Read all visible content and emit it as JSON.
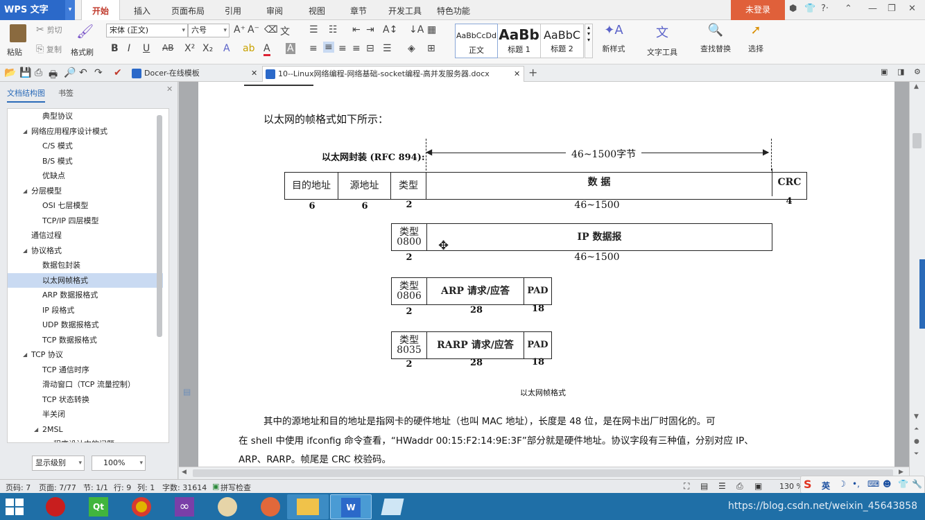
{
  "app": {
    "logo": "WPS 文字"
  },
  "menu_tabs": [
    "开始",
    "插入",
    "页面布局",
    "引用",
    "审阅",
    "视图",
    "章节",
    "开发工具",
    "特色功能"
  ],
  "login_label": "未登录",
  "ribbon": {
    "paste": "粘贴",
    "cut": "剪切",
    "copy": "复制",
    "format_painter": "格式刷",
    "font_name": "宋体 (正文)",
    "font_size": "六号",
    "styles": [
      {
        "preview": "AaBbCcDd",
        "name": "正文"
      },
      {
        "preview": "AaBb",
        "name": "标题 1"
      },
      {
        "preview": "AaBbC",
        "name": "标题 2"
      }
    ],
    "new_style": "新样式",
    "text_tools": "文字工具",
    "find_replace": "查找替换",
    "select": "选择"
  },
  "doc_tabs": [
    {
      "label": "Docer-在线模板"
    },
    {
      "label": "10--Linux网络编程-网络基础-socket编程-高并发服务器.docx"
    }
  ],
  "left_panel": {
    "tabs": [
      "文档结构图",
      "书签"
    ],
    "items": [
      {
        "label": "典型协议",
        "level": 2
      },
      {
        "label": "网络应用程序设计模式",
        "level": 1,
        "expanded": true
      },
      {
        "label": "C/S 模式",
        "level": 2
      },
      {
        "label": "B/S 模式",
        "level": 2
      },
      {
        "label": "优缺点",
        "level": 2
      },
      {
        "label": "分层模型",
        "level": 1,
        "expanded": true
      },
      {
        "label": "OSI 七层模型",
        "level": 2
      },
      {
        "label": "TCP/IP 四层模型",
        "level": 2
      },
      {
        "label": "通信过程",
        "level": 1
      },
      {
        "label": "协议格式",
        "level": 1,
        "expanded": true
      },
      {
        "label": "数据包封装",
        "level": 2
      },
      {
        "label": "以太网帧格式",
        "level": 2,
        "selected": true
      },
      {
        "label": "ARP 数据报格式",
        "level": 2
      },
      {
        "label": "IP 段格式",
        "level": 2
      },
      {
        "label": "UDP 数据报格式",
        "level": 2
      },
      {
        "label": "TCP 数据报格式",
        "level": 2
      },
      {
        "label": "TCP 协议",
        "level": 1,
        "expanded": true
      },
      {
        "label": "TCP 通信时序",
        "level": 2
      },
      {
        "label": "滑动窗口（TCP 流量控制）",
        "level": 2
      },
      {
        "label": "TCP 状态转换",
        "level": 2
      },
      {
        "label": "半关闭",
        "level": 2
      },
      {
        "label": "2MSL",
        "level": 2,
        "expanded": true
      },
      {
        "label": "程序设计中的问题",
        "level": 3
      }
    ],
    "level_select": "显示级别",
    "zoom_select": "100%"
  },
  "document": {
    "intro": "以太网的帧格式如下所示：",
    "encap_label": "以太网封装 (RFC 894):",
    "range_label": "46~1500字节",
    "row1": {
      "cells": [
        "目的地址",
        "源地址",
        "类型",
        "数 据",
        "CRC"
      ],
      "sizes": [
        "6",
        "6",
        "2",
        "46~1500",
        "4"
      ]
    },
    "row2": {
      "type_label": "类型",
      "type_code": "0800",
      "data": "IP 数据报",
      "sizes": [
        "2",
        "46~1500"
      ]
    },
    "row3": {
      "type_label": "类型",
      "type_code": "0806",
      "data": "ARP 请求/应答",
      "pad": "PAD",
      "sizes": [
        "2",
        "28",
        "18"
      ]
    },
    "row4": {
      "type_label": "类型",
      "type_code": "8035",
      "data": "RARP 请求/应答",
      "pad": "PAD",
      "sizes": [
        "2",
        "28",
        "18"
      ]
    },
    "caption": "以太网帧格式",
    "para_line1": "其中的源地址和目的地址是指网卡的硬件地址（也叫 MAC 地址），长度是 48 位，是在网卡出厂时固化的。可",
    "para_line2": "在 shell 中使用 ifconfig 命令查看，“HWaddr 00:15:F2:14:9E:3F”部分就是硬件地址。协议字段有三种值，分别对应 IP、",
    "para_line3": "ARP、RARP。帧尾是 CRC 校验码。"
  },
  "status_bar": {
    "page_num": "页码: 7",
    "pages": "页面: 7/77",
    "section": "节: 1/1",
    "row": "行: 9",
    "col": "列: 1",
    "word_count": "字数: 31614",
    "spell_check": "拼写检查",
    "zoom": "130 %"
  },
  "watermark": "https://blog.csdn.net/weixin_45643858"
}
